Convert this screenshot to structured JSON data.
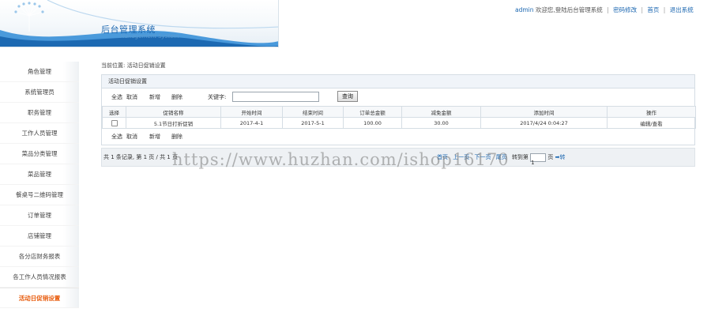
{
  "header": {
    "title": "后台管理系统",
    "subtitle": "Management System",
    "username": "admin",
    "welcome": "欢迎您,登陆后台管理系统",
    "links": [
      "密码修改",
      "首页",
      "退出系统"
    ]
  },
  "sidebar": {
    "items": [
      {
        "label": "角色管理",
        "active": false
      },
      {
        "label": "系统管理员",
        "active": false
      },
      {
        "label": "职务管理",
        "active": false
      },
      {
        "label": "工作人员管理",
        "active": false
      },
      {
        "label": "菜品分类管理",
        "active": false
      },
      {
        "label": "菜品管理",
        "active": false
      },
      {
        "label": "餐桌号二维码管理",
        "active": false
      },
      {
        "label": "订单管理",
        "active": false
      },
      {
        "label": "店铺管理",
        "active": false
      },
      {
        "label": "各分店财务报表",
        "active": false
      },
      {
        "label": "各工作人员情况报表",
        "active": false
      },
      {
        "label": "活动日促销设置",
        "active": true
      }
    ]
  },
  "location": "当前位置: 活动日促销设置",
  "panel": {
    "title": "活动日促销设置",
    "toolbar": {
      "select_all": "全选",
      "cancel": "取消",
      "add": "新增",
      "delete": "删除",
      "keyword_label": "关键字:",
      "keyword_value": "",
      "query": "查询"
    },
    "columns": [
      "选择",
      "促销名称",
      "开始时间",
      "结束时间",
      "订单总金额",
      "减免金额",
      "添加时间",
      "操作"
    ],
    "rows": [
      {
        "name": "5.1节日打折促销",
        "start": "2017-4-1",
        "end": "2017-5-1",
        "total": "100.00",
        "discount": "30.00",
        "added": "2017/4/24 0:04:27",
        "action": "编辑/查看"
      }
    ],
    "bottom": {
      "select_all": "全选",
      "cancel": "取消",
      "add": "新增",
      "delete": "删除"
    }
  },
  "pager": {
    "info": "共 1 条记录, 第 1 页 / 共 1 页",
    "first": "首页",
    "prev": "上一页",
    "next": "下一页",
    "last": "尾页",
    "goto_label": "转到第",
    "page_value": "1",
    "page_suffix": "页",
    "goto": "➡转"
  },
  "watermark": "https://www.huzhan.com/ishop16170",
  "colors": {
    "accent": "#1a66b0",
    "active_menu": "#e85c0e",
    "panel_header": "#f0f4f9",
    "pager_bg": "#eef1f4"
  }
}
